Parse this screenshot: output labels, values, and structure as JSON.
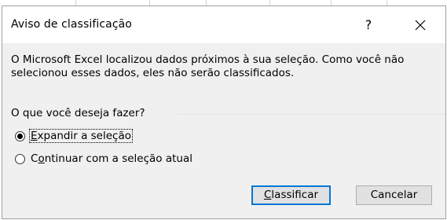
{
  "dialog": {
    "title": "Aviso de classificação",
    "help_label": "?",
    "message": "O Microsoft Excel localizou dados próximos à sua seleção. Como você não selecionou esses dados, eles não serão classificados.",
    "group_label": "O que você deseja fazer?",
    "options": [
      {
        "pre": "",
        "accel": "E",
        "post": "xpandir a seleção",
        "selected": true
      },
      {
        "pre": "C",
        "accel": "o",
        "post": "ntinuar com a seleção atual",
        "selected": false
      }
    ],
    "buttons": {
      "sort": {
        "accel": "C",
        "rest": "lassificar"
      },
      "cancel": "Cancelar"
    }
  },
  "colors": {
    "dialog_bg": "#f0f0f0",
    "titlebar_bg": "#ffffff",
    "primary_border": "#0078d7",
    "button_bg": "#e1e1e1"
  }
}
